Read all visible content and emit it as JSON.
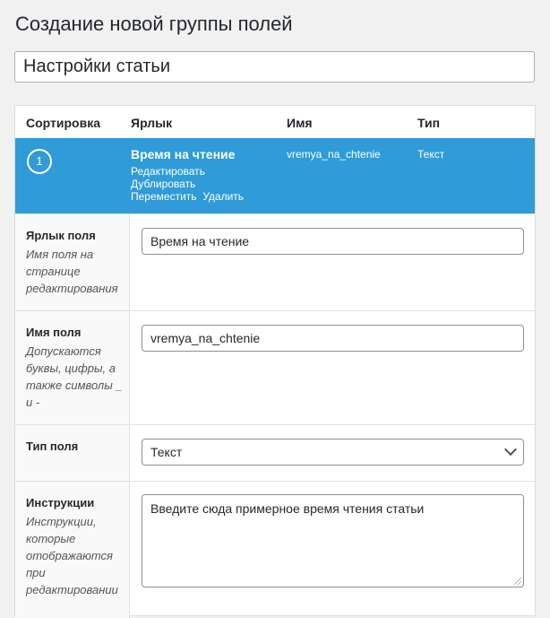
{
  "page": {
    "title": "Создание новой группы полей"
  },
  "group_title": {
    "value": "Настройки статьи"
  },
  "columns": {
    "order": "Сортировка",
    "label": "Ярлык",
    "name": "Имя",
    "type": "Тип"
  },
  "field_row": {
    "order": "1",
    "label": "Время на чтение",
    "name": "vremya_na_chtenie",
    "type": "Текст",
    "actions": {
      "edit": "Редактировать",
      "duplicate": "Дублировать",
      "move": "Переместить",
      "delete": "Удалить"
    },
    "bg_color": "#2f9bd8"
  },
  "settings": {
    "label": {
      "title": "Ярлык поля",
      "description": "Имя поля на странице редактирования",
      "value": "Время на чтение"
    },
    "name": {
      "title": "Имя поля",
      "description": "Допускаются буквы, цифры, а также символы _ и -",
      "value": "vremya_na_chtenie"
    },
    "type": {
      "title": "Тип поля",
      "selected": "Текст"
    },
    "instructions": {
      "title": "Инструкции",
      "description": "Инструкции, которые отображаются при редактировании",
      "value": "Введите сюда примерное время чтения статьи"
    }
  }
}
